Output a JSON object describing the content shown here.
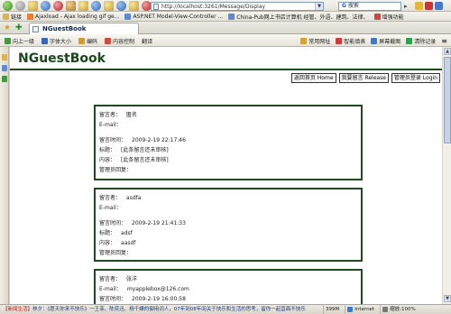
{
  "browser": {
    "address_url": "http://localhost:3261/Message/Display",
    "search_prefix": "G",
    "search_placeholder": "搜索",
    "tab_title": "NGuestBook",
    "links_toolbar": {
      "items": [
        "链接",
        "Ajaxload - Ajax loading gif ge...",
        "ASP.NET Model-View-Controller ...",
        "China-Pub网上书店计算机 经管、外语、建筑、法律、",
        "增强功能"
      ]
    },
    "command_bar": {
      "left_items": [
        "向上一级",
        "字体大小",
        "编码",
        "内容控制",
        "翻译"
      ],
      "right_items": [
        "常用网址",
        "智能填表",
        "屏幕截图",
        "清除记录"
      ]
    },
    "status_bar": {
      "message_tag": "【新闻生活】",
      "message": "林夕：《愿天你来不快乐》一王菲、陈奕迅、杨千嬅的御用词人，07年到08年间关于快乐和生活的思考，留你一起直面不快乐",
      "progress": "399M",
      "zone": "Internet",
      "zoom_label": "缩放:100%"
    }
  },
  "page": {
    "site_title": "NGuestBook",
    "nav_buttons": [
      "返回首页 Home",
      "我要留言 Release",
      "管理员登录 Login"
    ],
    "entries": [
      {
        "author_label": "留言者：",
        "author": "匿名",
        "email_label": "E-mail：",
        "email": "",
        "time_label": "留言时间：",
        "time": "2009-2-19 22:17:46",
        "subject_label": "标题：",
        "subject": "[此条留言还未审核]",
        "content_label": "内容：",
        "content": "[此条留言还未审核]",
        "reply_label": "管理员回复：",
        "reply": ""
      },
      {
        "author_label": "留言者：",
        "author": "asdfa",
        "email_label": "E-mail：",
        "email": "",
        "time_label": "留言时间：",
        "time": "2009-2-19 21:41:33",
        "subject_label": "标题：",
        "subject": "adsf",
        "content_label": "内容：",
        "content": "aasdf",
        "reply_label": "管理员回复：",
        "reply": ""
      },
      {
        "author_label": "留言者：",
        "author": "张洋",
        "email_label": "E-mail：",
        "email": "myapplebox@126.com",
        "time_label": "留言时间：",
        "time": "2009-2-19 16:00:58"
      }
    ]
  }
}
